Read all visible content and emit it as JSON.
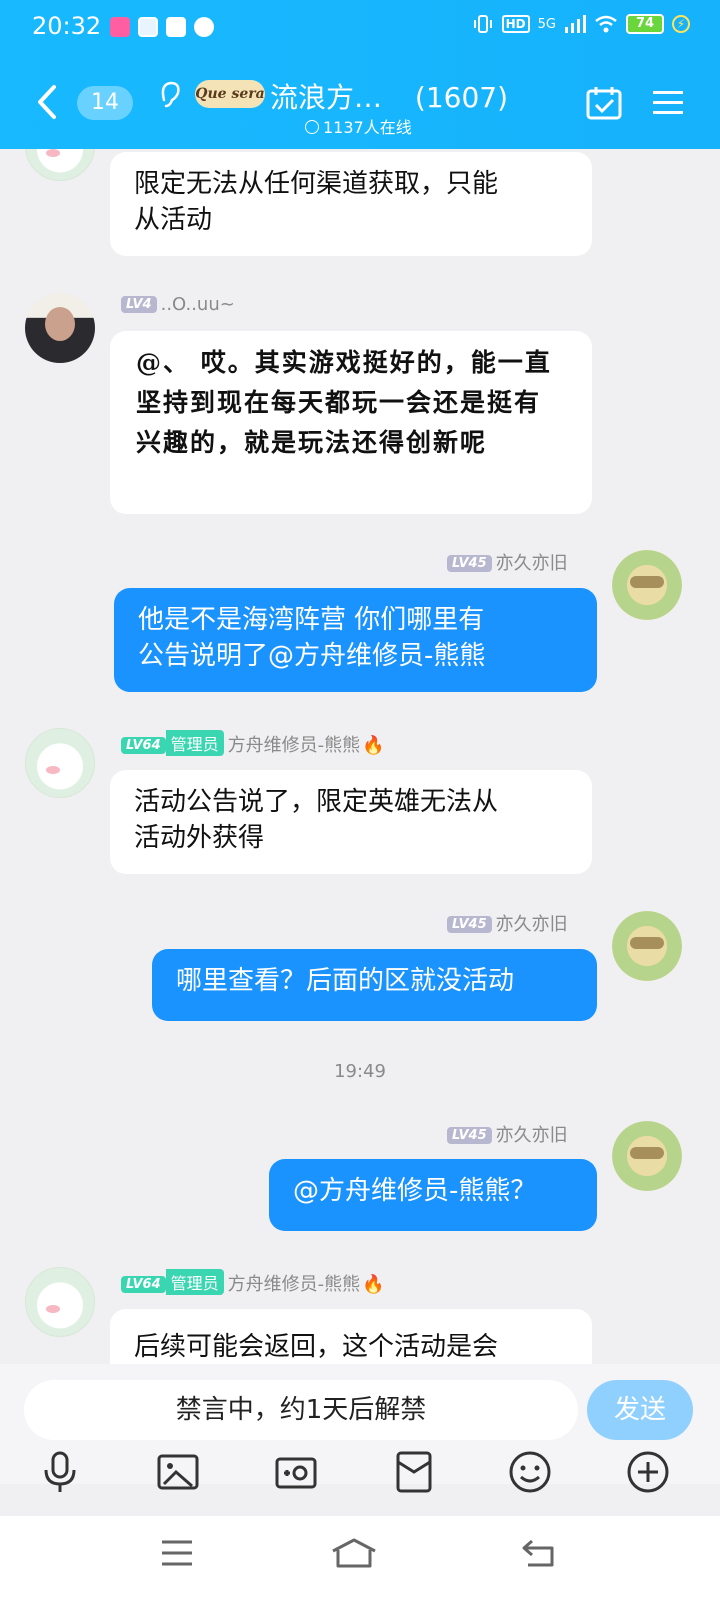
{
  "status_bar": {
    "time": "20:32",
    "network": "5G",
    "hd": "HD",
    "battery": "74"
  },
  "header": {
    "back_count": "14",
    "logo_text": "Que sera",
    "group_name": "流浪方…",
    "member_count": "(1607)",
    "online_text": "1137人在线",
    "accent_color": "#18b9ff"
  },
  "messages": [
    {
      "side": "in",
      "text_line1": "限定无法从任何渠道获取，只能",
      "text_line2": "从活动"
    },
    {
      "side": "in",
      "level": "LV4",
      "name": "..O..uu~",
      "text": "@、 哎。其实游戏挺好的，能一直坚持到现在每天都玩一会还是挺有兴趣的，就是玩法还得创新呢"
    },
    {
      "side": "out",
      "level": "LV45",
      "name": "亦久亦旧",
      "text_line1": "他是不是海湾阵营  你们哪里有",
      "text_line2": "公告说明了@方舟维修员-熊熊"
    },
    {
      "side": "in",
      "level": "LV64",
      "role": "管理员",
      "name": "方舟维修员-熊熊",
      "text_line1": "活动公告说了，限定英雄无法从",
      "text_line2": "活动外获得"
    },
    {
      "side": "out",
      "level": "LV45",
      "name": "亦久亦旧",
      "text": "哪里查看？后面的区就没活动"
    },
    {
      "timestamp": "19:49"
    },
    {
      "side": "out",
      "level": "LV45",
      "name": "亦久亦旧",
      "text": "@方舟维修员-熊熊？"
    },
    {
      "side": "in",
      "level": "LV64",
      "role": "管理员",
      "name": "方舟维修员-熊熊",
      "text": "后续可能会返回，这个活动是会"
    }
  ],
  "input": {
    "mute_text": "禁言中，约1天后解禁",
    "send_label": "发送"
  }
}
